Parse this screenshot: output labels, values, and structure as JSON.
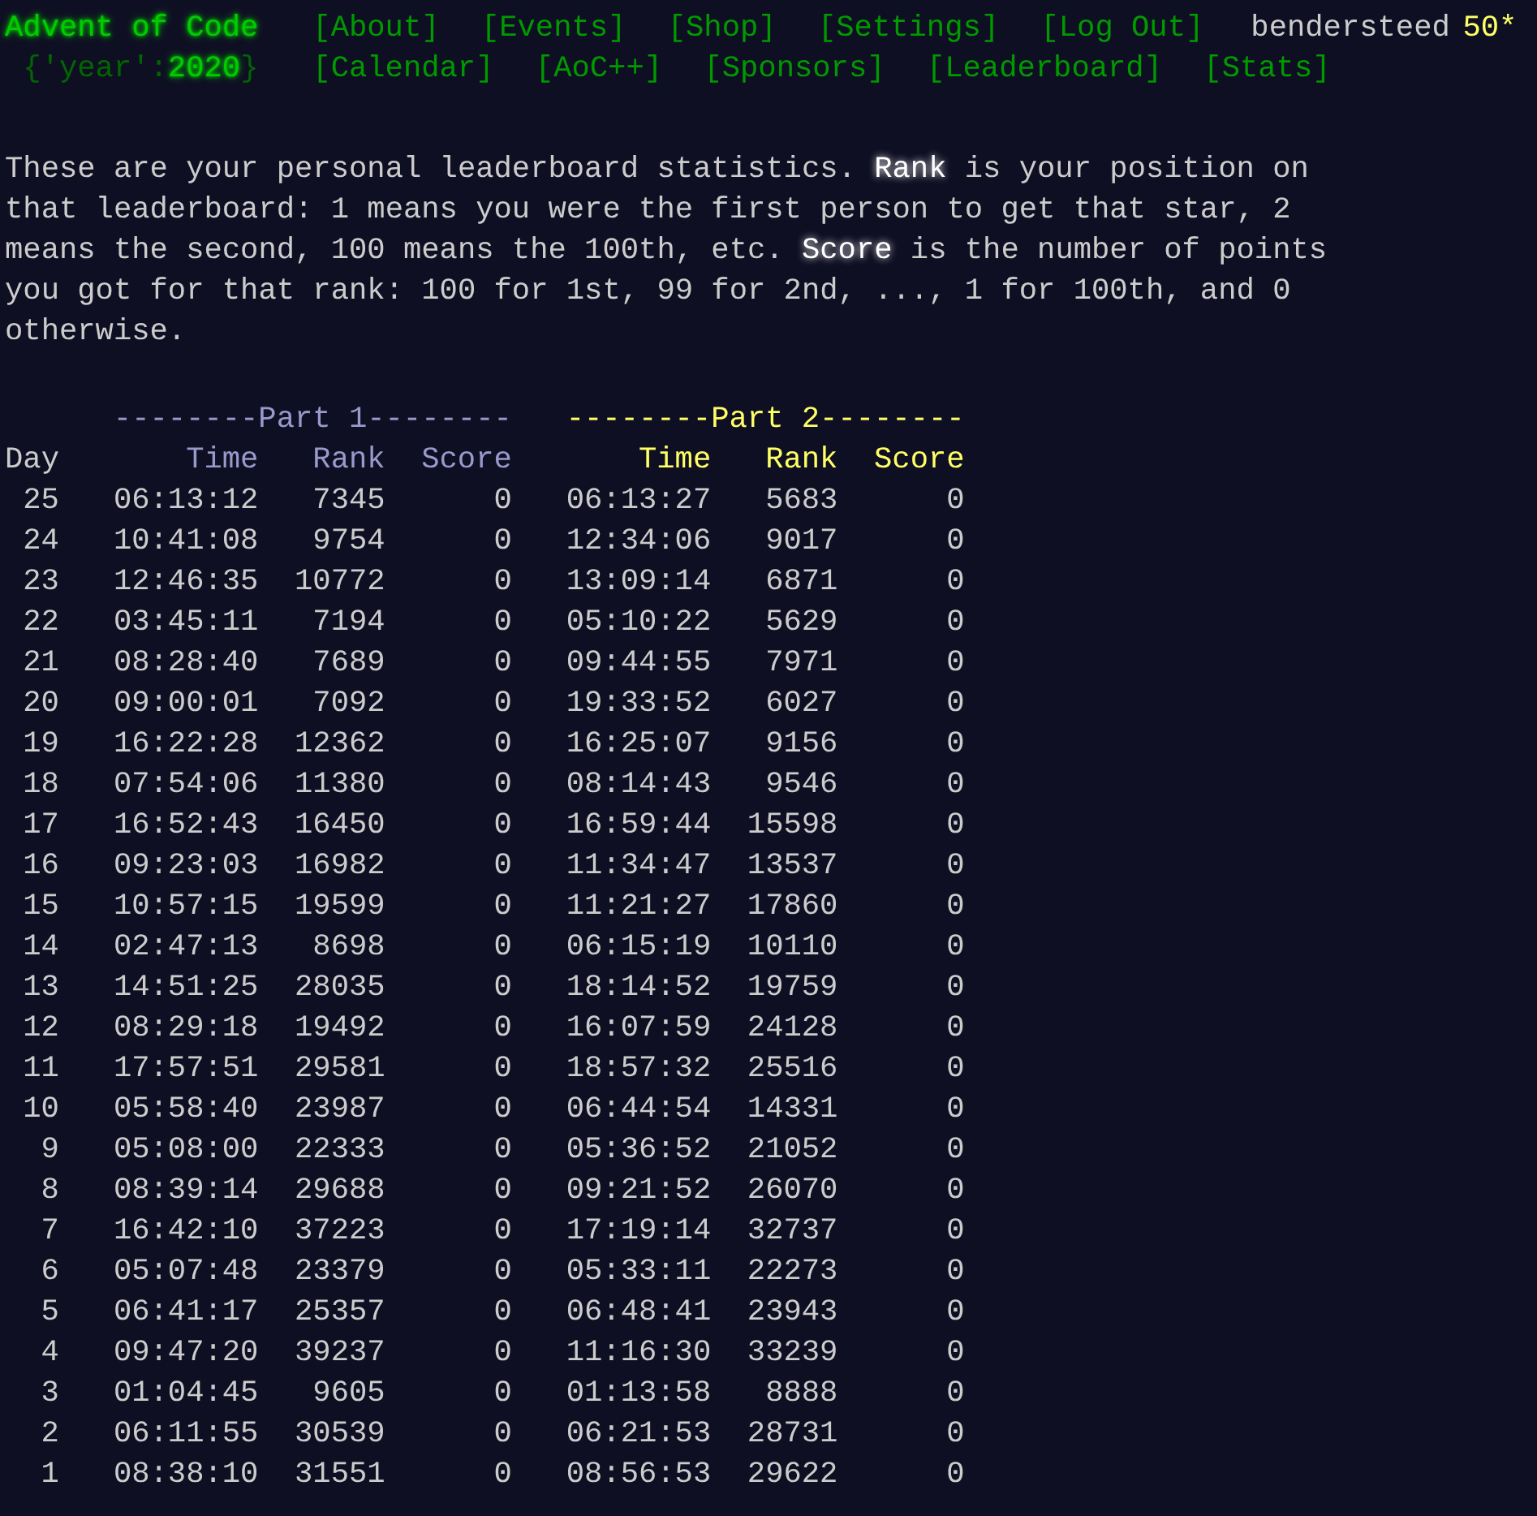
{
  "header": {
    "title": "Advent of Code",
    "year_prefix": "{'year':",
    "year": "2020",
    "year_suffix": "}",
    "nav_top": [
      "[About]",
      "[Events]",
      "[Shop]",
      "[Settings]",
      "[Log Out]"
    ],
    "user": "bendersteed",
    "stars": "50*",
    "nav_bottom": [
      "[Calendar]",
      "[AoC++]",
      "[Sponsors]",
      "[Leaderboard]",
      "[Stats]"
    ]
  },
  "intro": "These are your personal leaderboard statistics. **Rank** is your position on that leaderboard: 1 means you were the first person to get that star, 2 means the second, 100 means the 100th, etc. **Score** is the number of points you got for that rank: 100 for 1st, 99 for 2nd, ..., 1 for 100th, and 0 otherwise.",
  "table": {
    "day_heading": "Day",
    "parts": [
      {
        "title": "--------Part 1--------",
        "color": "#9999cc",
        "columns": [
          "Time",
          "Rank",
          "Score"
        ]
      },
      {
        "title": "--------Part 2--------",
        "color": "#ffff66",
        "columns": [
          "Time",
          "Rank",
          "Score"
        ]
      }
    ],
    "rows": [
      {
        "day": "25",
        "part_1": [
          "06:13:12",
          "7345",
          "0"
        ],
        "part_2": [
          "06:13:27",
          "5683",
          "0"
        ]
      },
      {
        "day": "24",
        "part_1": [
          "10:41:08",
          "9754",
          "0"
        ],
        "part_2": [
          "12:34:06",
          "9017",
          "0"
        ]
      },
      {
        "day": "23",
        "part_1": [
          "12:46:35",
          "10772",
          "0"
        ],
        "part_2": [
          "13:09:14",
          "6871",
          "0"
        ]
      },
      {
        "day": "22",
        "part_1": [
          "03:45:11",
          "7194",
          "0"
        ],
        "part_2": [
          "05:10:22",
          "5629",
          "0"
        ]
      },
      {
        "day": "21",
        "part_1": [
          "08:28:40",
          "7689",
          "0"
        ],
        "part_2": [
          "09:44:55",
          "7971",
          "0"
        ]
      },
      {
        "day": "20",
        "part_1": [
          "09:00:01",
          "7092",
          "0"
        ],
        "part_2": [
          "19:33:52",
          "6027",
          "0"
        ]
      },
      {
        "day": "19",
        "part_1": [
          "16:22:28",
          "12362",
          "0"
        ],
        "part_2": [
          "16:25:07",
          "9156",
          "0"
        ]
      },
      {
        "day": "18",
        "part_1": [
          "07:54:06",
          "11380",
          "0"
        ],
        "part_2": [
          "08:14:43",
          "9546",
          "0"
        ]
      },
      {
        "day": "17",
        "part_1": [
          "16:52:43",
          "16450",
          "0"
        ],
        "part_2": [
          "16:59:44",
          "15598",
          "0"
        ]
      },
      {
        "day": "16",
        "part_1": [
          "09:23:03",
          "16982",
          "0"
        ],
        "part_2": [
          "11:34:47",
          "13537",
          "0"
        ]
      },
      {
        "day": "15",
        "part_1": [
          "10:57:15",
          "19599",
          "0"
        ],
        "part_2": [
          "11:21:27",
          "17860",
          "0"
        ]
      },
      {
        "day": "14",
        "part_1": [
          "02:47:13",
          "8698",
          "0"
        ],
        "part_2": [
          "06:15:19",
          "10110",
          "0"
        ]
      },
      {
        "day": "13",
        "part_1": [
          "14:51:25",
          "28035",
          "0"
        ],
        "part_2": [
          "18:14:52",
          "19759",
          "0"
        ]
      },
      {
        "day": "12",
        "part_1": [
          "08:29:18",
          "19492",
          "0"
        ],
        "part_2": [
          "16:07:59",
          "24128",
          "0"
        ]
      },
      {
        "day": "11",
        "part_1": [
          "17:57:51",
          "29581",
          "0"
        ],
        "part_2": [
          "18:57:32",
          "25516",
          "0"
        ]
      },
      {
        "day": "10",
        "part_1": [
          "05:58:40",
          "23987",
          "0"
        ],
        "part_2": [
          "06:44:54",
          "14331",
          "0"
        ]
      },
      {
        "day": "9",
        "part_1": [
          "05:08:00",
          "22333",
          "0"
        ],
        "part_2": [
          "05:36:52",
          "21052",
          "0"
        ]
      },
      {
        "day": "8",
        "part_1": [
          "08:39:14",
          "29688",
          "0"
        ],
        "part_2": [
          "09:21:52",
          "26070",
          "0"
        ]
      },
      {
        "day": "7",
        "part_1": [
          "16:42:10",
          "37223",
          "0"
        ],
        "part_2": [
          "17:19:14",
          "32737",
          "0"
        ]
      },
      {
        "day": "6",
        "part_1": [
          "05:07:48",
          "23379",
          "0"
        ],
        "part_2": [
          "05:33:11",
          "22273",
          "0"
        ]
      },
      {
        "day": "5",
        "part_1": [
          "06:41:17",
          "25357",
          "0"
        ],
        "part_2": [
          "06:48:41",
          "23943",
          "0"
        ]
      },
      {
        "day": "4",
        "part_1": [
          "09:47:20",
          "39237",
          "0"
        ],
        "part_2": [
          "11:16:30",
          "33239",
          "0"
        ]
      },
      {
        "day": "3",
        "part_1": [
          "01:04:45",
          "9605",
          "0"
        ],
        "part_2": [
          "01:13:58",
          "8888",
          "0"
        ]
      },
      {
        "day": "2",
        "part_1": [
          "06:11:55",
          "30539",
          "0"
        ],
        "part_2": [
          "06:21:53",
          "28731",
          "0"
        ]
      },
      {
        "day": "1",
        "part_1": [
          "08:38:10",
          "31551",
          "0"
        ],
        "part_2": [
          "08:56:53",
          "29622",
          "0"
        ]
      }
    ]
  }
}
